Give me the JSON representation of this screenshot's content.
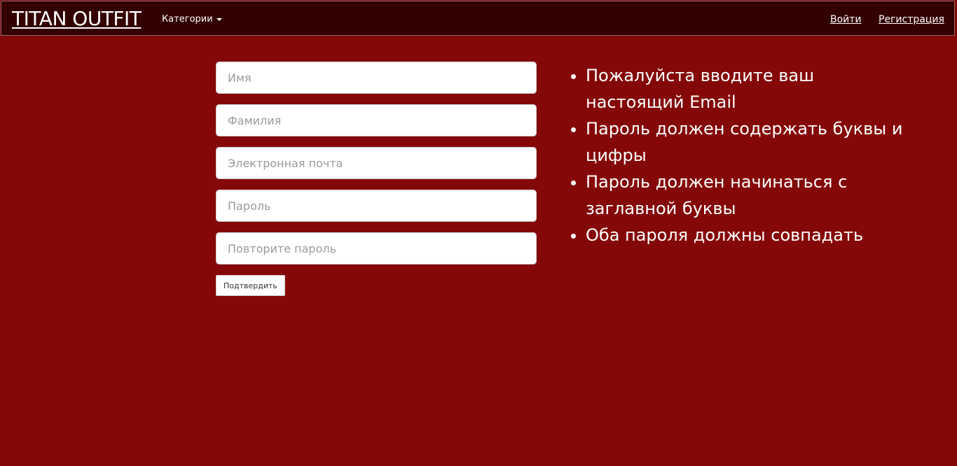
{
  "navbar": {
    "brand": "TITAN OUTFIT",
    "categories_label": "Категории",
    "login_label": "Войти",
    "register_label": "Регистрация"
  },
  "form": {
    "first_name_placeholder": "Имя",
    "last_name_placeholder": "Фамилия",
    "email_placeholder": "Электронная почта",
    "password_placeholder": "Пароль",
    "password_repeat_placeholder": "Повторите пароль",
    "submit_label": "Подтвердить"
  },
  "rules": [
    "Пожалуйста вводите ваш настоящий Email",
    "Пароль должен содержать буквы и цифры",
    "Пароль должен начинаться с заглавной буквы",
    "Оба пароля должны совпадать"
  ],
  "colors": {
    "page_background": "#850808",
    "navbar_background": "#330000"
  }
}
